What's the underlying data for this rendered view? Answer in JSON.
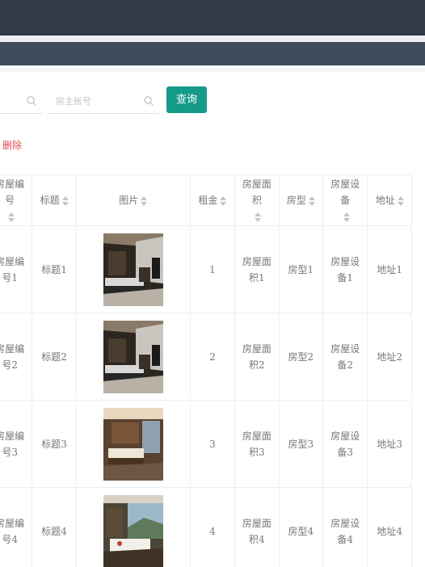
{
  "search": {
    "placeholder_1": "",
    "placeholder_2": "房主账号",
    "button_label": "查询"
  },
  "actions": {
    "delete_label": "删除"
  },
  "table": {
    "headers": [
      "房屋编号",
      "标题",
      "图片",
      "租金",
      "房屋面积",
      "房型",
      "房屋设备",
      "地址"
    ],
    "rows": [
      {
        "house_no": "房屋编号1",
        "title": "标题1",
        "image": "bedroom-photo",
        "rent": "1",
        "area": "房屋面积1",
        "type": "房型1",
        "equipment": "房屋设备1",
        "address": "地址1"
      },
      {
        "house_no": "房屋编号2",
        "title": "标题2",
        "image": "bedroom-photo",
        "rent": "2",
        "area": "房屋面积2",
        "type": "房型2",
        "equipment": "房屋设备2",
        "address": "地址2"
      },
      {
        "house_no": "房屋编号3",
        "title": "标题3",
        "image": "bedroom-photo",
        "rent": "3",
        "area": "房屋面积3",
        "type": "房型3",
        "equipment": "房屋设备3",
        "address": "地址3"
      },
      {
        "house_no": "房屋编号4",
        "title": "标题4",
        "image": "bedroom-photo",
        "rent": "4",
        "area": "房屋面积4",
        "type": "房型4",
        "equipment": "房屋设备4",
        "address": "地址4"
      }
    ]
  },
  "colors": {
    "topbar": "#303b47",
    "navbar": "#3e4b5a",
    "accent": "#159a8a",
    "danger": "#e04e4e"
  }
}
